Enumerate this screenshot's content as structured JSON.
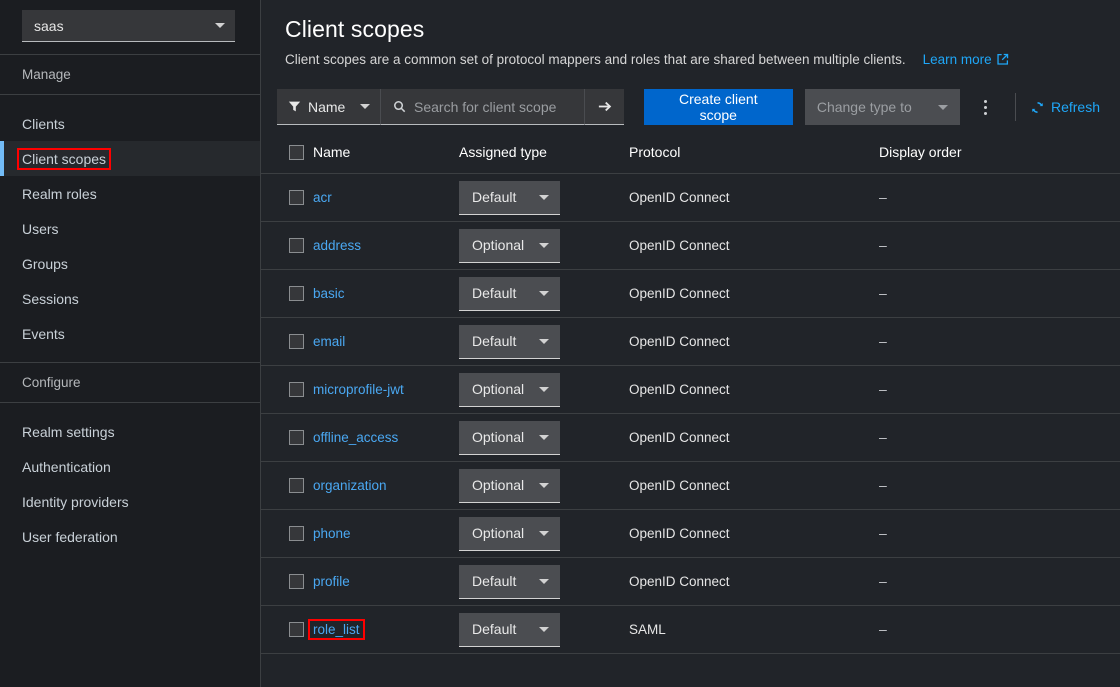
{
  "sidebar": {
    "realm_selector": {
      "value": "saas",
      "icon": "chevron-down-icon"
    },
    "sections": [
      {
        "title": "Manage",
        "items": [
          {
            "label": "Clients",
            "active": false,
            "annotated": false
          },
          {
            "label": "Client scopes",
            "active": true,
            "annotated": true
          },
          {
            "label": "Realm roles",
            "active": false,
            "annotated": false
          },
          {
            "label": "Users",
            "active": false,
            "annotated": false
          },
          {
            "label": "Groups",
            "active": false,
            "annotated": false
          },
          {
            "label": "Sessions",
            "active": false,
            "annotated": false
          },
          {
            "label": "Events",
            "active": false,
            "annotated": false
          }
        ]
      },
      {
        "title": "Configure",
        "items": [
          {
            "label": "Realm settings",
            "active": false,
            "annotated": false
          },
          {
            "label": "Authentication",
            "active": false,
            "annotated": false
          },
          {
            "label": "Identity providers",
            "active": false,
            "annotated": false
          },
          {
            "label": "User federation",
            "active": false,
            "annotated": false
          }
        ]
      }
    ]
  },
  "header": {
    "title": "Client scopes",
    "description": "Client scopes are a common set of protocol mappers and roles that are shared between multiple clients.",
    "learn_more_label": "Learn more",
    "learn_more_icon": "external-link-icon"
  },
  "toolbar": {
    "filter": {
      "label": "Name",
      "icon": "filter-funnel-icon",
      "caret": "chevron-down-icon"
    },
    "search": {
      "value": "",
      "placeholder": "Search for client scope",
      "icon": "search-icon"
    },
    "search_submit_icon": "arrow-right-icon",
    "create_label": "Create client scope",
    "change_type": {
      "label": "Change type to",
      "disabled": true,
      "caret": "chevron-down-icon"
    },
    "kebab_icon": "kebab-vertical-icon",
    "refresh": {
      "label": "Refresh",
      "icon": "refresh-icon"
    }
  },
  "table": {
    "columns": [
      "Name",
      "Assigned type",
      "Protocol",
      "Display order"
    ],
    "select_all_checkbox": false,
    "rows": [
      {
        "name": "acr",
        "assigned_type": "Default",
        "protocol": "OpenID Connect",
        "display_order": "–",
        "annotated": false
      },
      {
        "name": "address",
        "assigned_type": "Optional",
        "protocol": "OpenID Connect",
        "display_order": "–",
        "annotated": false
      },
      {
        "name": "basic",
        "assigned_type": "Default",
        "protocol": "OpenID Connect",
        "display_order": "–",
        "annotated": false
      },
      {
        "name": "email",
        "assigned_type": "Default",
        "protocol": "OpenID Connect",
        "display_order": "–",
        "annotated": false
      },
      {
        "name": "microprofile-jwt",
        "assigned_type": "Optional",
        "protocol": "OpenID Connect",
        "display_order": "–",
        "annotated": false
      },
      {
        "name": "offline_access",
        "assigned_type": "Optional",
        "protocol": "OpenID Connect",
        "display_order": "–",
        "annotated": false
      },
      {
        "name": "organization",
        "assigned_type": "Optional",
        "protocol": "OpenID Connect",
        "display_order": "–",
        "annotated": false
      },
      {
        "name": "phone",
        "assigned_type": "Optional",
        "protocol": "OpenID Connect",
        "display_order": "–",
        "annotated": false
      },
      {
        "name": "profile",
        "assigned_type": "Default",
        "protocol": "OpenID Connect",
        "display_order": "–",
        "annotated": false
      },
      {
        "name": "role_list",
        "assigned_type": "Default",
        "protocol": "SAML",
        "display_order": "–",
        "annotated": true
      }
    ]
  },
  "colors": {
    "primary_blue": "#0066cc",
    "link_blue": "#4aa8f2",
    "annotation_red": "#ff0000",
    "sidebar_bg": "#1b1d21",
    "main_bg": "#212429",
    "active_accent": "#73bcf7"
  }
}
